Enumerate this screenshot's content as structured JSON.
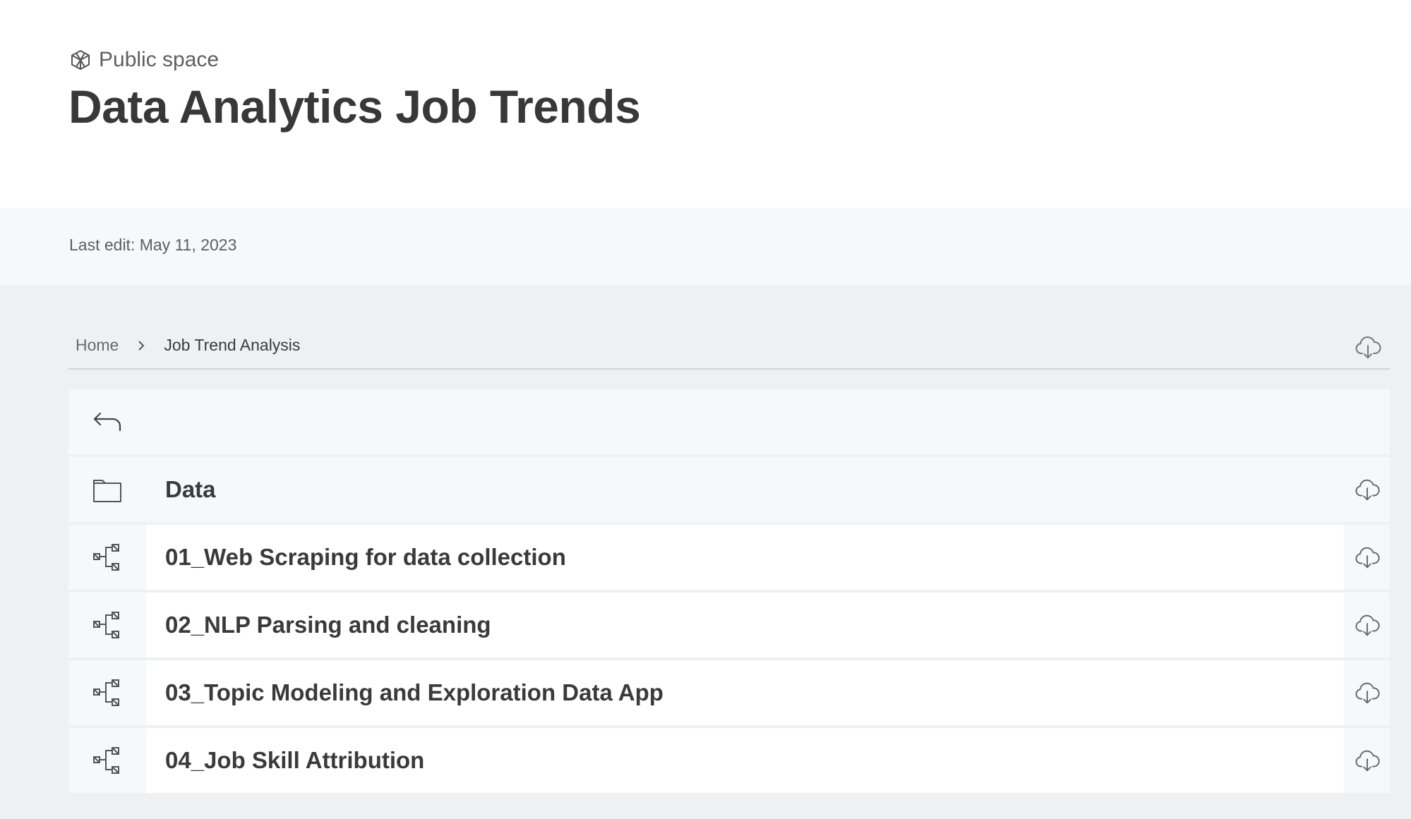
{
  "space": {
    "label": "Public space",
    "icon": "cube-icon"
  },
  "page": {
    "title": "Data Analytics Job Trends",
    "last_edit": "Last edit: May 11, 2023"
  },
  "breadcrumb": {
    "home": "Home",
    "current": "Job Trend Analysis"
  },
  "items": [
    {
      "label": "Data",
      "type": "folder",
      "icon": "folder-icon"
    },
    {
      "label": "01_Web Scraping for data collection",
      "type": "workflow",
      "icon": "workflow-icon"
    },
    {
      "label": "02_NLP Parsing and cleaning",
      "type": "workflow",
      "icon": "workflow-icon"
    },
    {
      "label": "03_Topic Modeling and Exploration Data App",
      "type": "workflow",
      "icon": "workflow-icon"
    },
    {
      "label": "04_Job Skill Attribution",
      "type": "workflow",
      "icon": "workflow-icon"
    }
  ],
  "colors": {
    "text": "#3a3a3a",
    "muted": "#5f5f5f",
    "band": "#f7f8f9",
    "content_bg": "#eff0f1",
    "row_bg": "#ffffff"
  }
}
